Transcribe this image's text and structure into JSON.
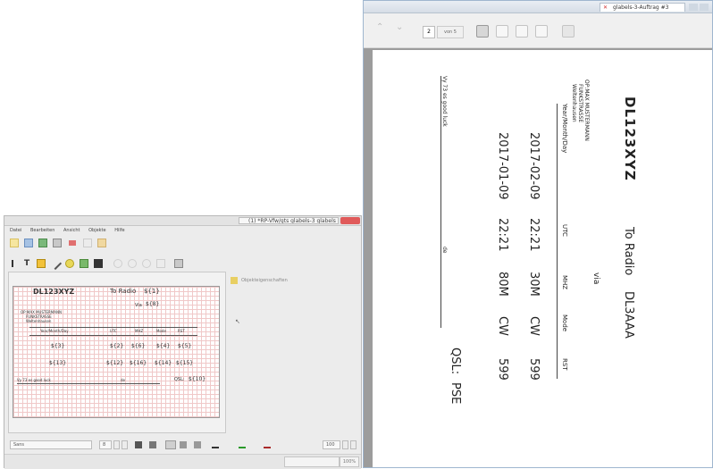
{
  "editor": {
    "title": "(1) *RP-Vfw/gts glabels-3 glabels",
    "menu": [
      "Datei",
      "Bearbeiten",
      "Ansicht",
      "Objekte",
      "Hilfe"
    ],
    "side_panel_label": "Objekteigenschaften",
    "label": {
      "callsign": "DL123XYZ",
      "to_radio": "To Radio",
      "to_radio_var": "${1}",
      "via_label": "Via",
      "via_var": "${8}",
      "address_lines": [
        "OP:MAX MUSTERMANN",
        "FUNKSTRASSE",
        "Weltenhausen"
      ],
      "headers": [
        "Year/Month/Day",
        "UTC",
        "MHZ",
        "Mode",
        "RST"
      ],
      "row1": [
        "${3}",
        "${2}",
        "${6}",
        "${4}",
        "${5}"
      ],
      "row2": [
        "${13}",
        "${12}",
        "${16}",
        "${14}",
        "${15}"
      ],
      "footer_left": "Vy 73 es good luck",
      "footer_mid": "de",
      "qsl_label": "QSL:",
      "qsl_var": "${10}"
    },
    "font_combo": "Sans",
    "font_size": "8",
    "zoom_combo": "100",
    "status_zoom": "100%"
  },
  "preview": {
    "title": "glabels-3-Auftrag #3",
    "page_number": "2",
    "page_of": "von 5",
    "label": {
      "callsign": "DL123XYZ",
      "to_radio": "To Radio",
      "to_radio_value": "DL3AAA",
      "via_label": "via",
      "address_lines": [
        "OP:MAX MUSTERMANN",
        "FUNKSTRASSE",
        "Weltenhausen"
      ],
      "headers": [
        "Year/Month/Day",
        "UTC",
        "MHZ",
        "Mode",
        "RST"
      ],
      "rows": [
        [
          "2017-02-09",
          "22:21",
          "30M",
          "CW",
          "599"
        ],
        [
          "2017-01-09",
          "22:21",
          "80M",
          "CW",
          "599"
        ]
      ],
      "footer_left": "Vy 73 es good luck",
      "footer_mid": "de",
      "qsl_label": "QSL:",
      "qsl_value": "PSE"
    }
  },
  "colors": {
    "grid_pink": "#f0c8c8",
    "close_red": "#e05a5a",
    "preview_bg": "#9c9c9c",
    "titlebar_blue": "#d6dde6"
  }
}
